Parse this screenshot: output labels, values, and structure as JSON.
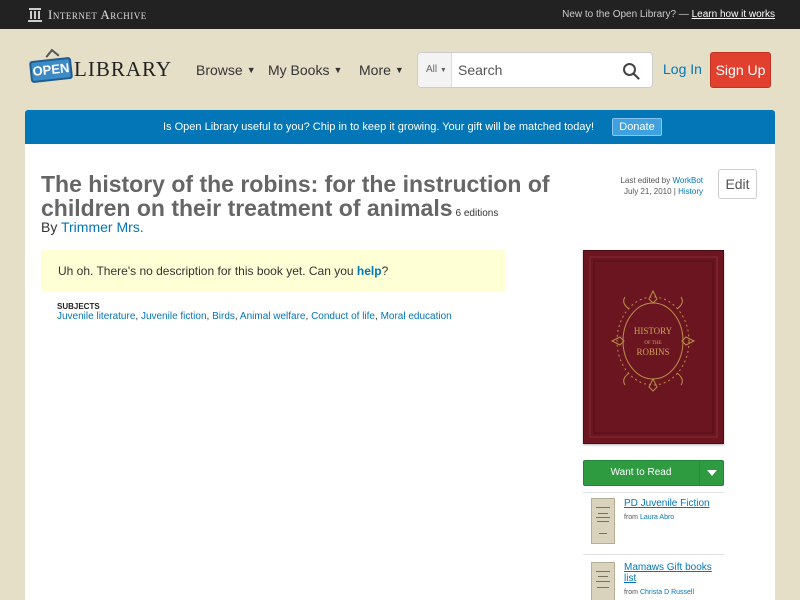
{
  "ia_bar": {
    "logo_text": "Internet Archive",
    "new_text": "New to the Open Library? —",
    "learn_link": "Learn how it works"
  },
  "header": {
    "logo_open": "OPEN",
    "logo_library": "LIBRARY",
    "nav": [
      {
        "label": "Browse"
      },
      {
        "label": "My Books"
      },
      {
        "label": "More"
      }
    ],
    "search": {
      "scope": "All",
      "placeholder": "Search"
    },
    "login": "Log In",
    "signup": "Sign Up"
  },
  "donate": {
    "message": "Is Open Library useful to you? Chip in to keep it growing. Your gift will be matched today!",
    "button": "Donate"
  },
  "book": {
    "title": "The history of the robins: for the instruction of children on their treatment of animals",
    "editions": "6 editions",
    "by_label": "By",
    "author": "Trimmer Mrs.",
    "last_edited_label": "Last edited by",
    "last_edited_by": "WorkBot",
    "edited_date": "July 21, 2010",
    "history_link": "History",
    "edit_button": "Edit",
    "no_description_prefix": "Uh oh. There's no description for this book yet. Can you",
    "help_link": "help",
    "no_description_suffix": "?",
    "subjects_heading": "SUBJECTS",
    "subjects": [
      "Juvenile literature",
      "Juvenile fiction",
      "Birds",
      "Animal welfare",
      "Conduct of life",
      "Moral education"
    ],
    "cover_text_1": "HISTORY",
    "cover_text_2": "OF THE",
    "cover_text_3": "ROBINS"
  },
  "sidebar": {
    "want_to_read": "Want to Read",
    "lists": [
      {
        "title": "PD Juvenile Fiction",
        "from_label": "from",
        "owner": "Laura Abro"
      },
      {
        "title": "Mamaws Gift books list",
        "from_label": "from",
        "owner": "Christa D Russell"
      }
    ]
  },
  "colors": {
    "accent_blue": "#0376b8",
    "signup_red": "#e1402e",
    "want_green": "#2e9b40",
    "cover_maroon": "#6b1521"
  }
}
